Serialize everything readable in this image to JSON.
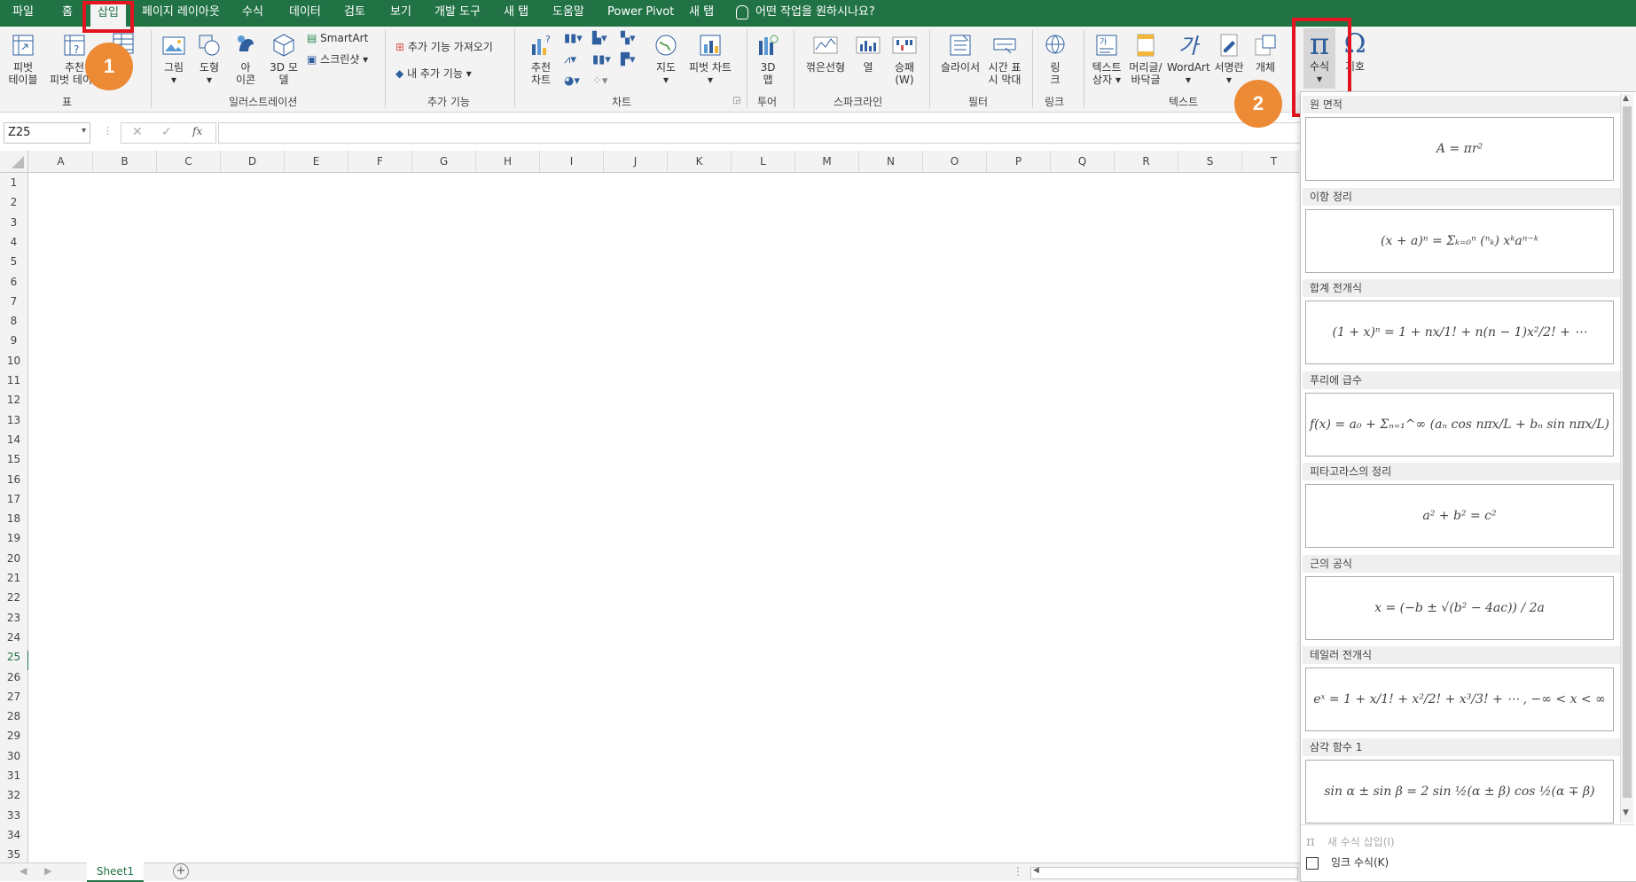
{
  "menu": [
    "파일",
    "홈",
    "삽입",
    "페이지 레이아웃",
    "수식",
    "데이터",
    "검토",
    "보기",
    "개발 도구",
    "새 탭",
    "도움말",
    "Power Pivot",
    "새 탭"
  ],
  "tell_me": "어떤 작업을 원하시나요?",
  "ribbon": {
    "pivot_table": [
      "피벗",
      "테이블"
    ],
    "recommended_pivot": [
      "추천",
      "피벗 테이블"
    ],
    "table_group": "표",
    "picture": "그림",
    "shapes": "도형",
    "icons": [
      "아",
      "이콘"
    ],
    "model3d": [
      "3D 모",
      "델"
    ],
    "smartart": "SmartArt",
    "screenshot": "스크린샷",
    "illustrations_group": "일러스트레이션",
    "get_addins": "추가 기능 가져오기",
    "my_addins": "내 추가 기능",
    "addins_group": "추가 기능",
    "recommended_charts": [
      "추천",
      "차트"
    ],
    "maps": "지도",
    "pivot_chart": "피벗 차트",
    "charts_group": "차트",
    "map3d": [
      "3D",
      "맵"
    ],
    "tours_group": "투어",
    "line": "꺾은선형",
    "column": "열",
    "winloss": [
      "승패",
      "(W)"
    ],
    "sparklines_group": "스파크라인",
    "slicer": "슬라이서",
    "timeline": [
      "시간 표",
      "시 막대"
    ],
    "filters_group": "필터",
    "link": [
      "링",
      "크"
    ],
    "links_group": "링크",
    "textbox": [
      "텍스트",
      "상자"
    ],
    "header_footer": [
      "머리글/",
      "바닥글"
    ],
    "wordart": "WordArt",
    "signature": "서명란",
    "object": "개체",
    "text_group": "텍스트",
    "equation": "수식",
    "symbol": "기호"
  },
  "name_box": "Z25",
  "fx": "fx",
  "columns": [
    "A",
    "B",
    "C",
    "D",
    "E",
    "F",
    "G",
    "H",
    "I",
    "J",
    "K",
    "L",
    "M",
    "N",
    "O",
    "P",
    "Q",
    "R",
    "S",
    "T"
  ],
  "rows": [
    "1",
    "2",
    "3",
    "4",
    "5",
    "6",
    "7",
    "8",
    "9",
    "10",
    "11",
    "12",
    "13",
    "14",
    "15",
    "16",
    "17",
    "18",
    "19",
    "20",
    "21",
    "22",
    "23",
    "24",
    "25",
    "26",
    "27",
    "28",
    "29",
    "30",
    "31",
    "32",
    "33",
    "34",
    "35"
  ],
  "sheet_tab": "Sheet1",
  "callouts": [
    "1",
    "2"
  ],
  "equations": [
    {
      "title": "원 면적",
      "formula": "A = πr²"
    },
    {
      "title": "이항 정리",
      "formula": "(x + a)ⁿ = Σₖ₌₀ⁿ (ⁿₖ) xᵏaⁿ⁻ᵏ"
    },
    {
      "title": "합계 전개식",
      "formula": "(1 + x)ⁿ = 1 + nx/1! + n(n − 1)x²/2! + ⋯"
    },
    {
      "title": "푸리에 급수",
      "formula": "f(x) = a₀ + Σₙ₌₁^∞ (aₙ cos nπx/L + bₙ sin nπx/L)"
    },
    {
      "title": "피타고라스의 정리",
      "formula": "a² + b² = c²"
    },
    {
      "title": "근의 공식",
      "formula": "x = (−b ± √(b² − 4ac)) / 2a"
    },
    {
      "title": "테일러 전개식",
      "formula": "eˣ = 1 + x/1! + x²/2! + x³/3! + ⋯ ,    −∞ < x < ∞"
    },
    {
      "title": "삼각 함수 1",
      "formula": "sin α ± sin β = 2 sin ½(α ± β) cos ½(α ∓ β)"
    }
  ],
  "panel_footer": {
    "new_equation": "새 수식 삽입(I)",
    "ink_equation": "잉크 수식(K)"
  },
  "colors": {
    "excel_green": "#217346",
    "callout_orange": "#ec8a35",
    "highlight_red": "#e3141f"
  }
}
